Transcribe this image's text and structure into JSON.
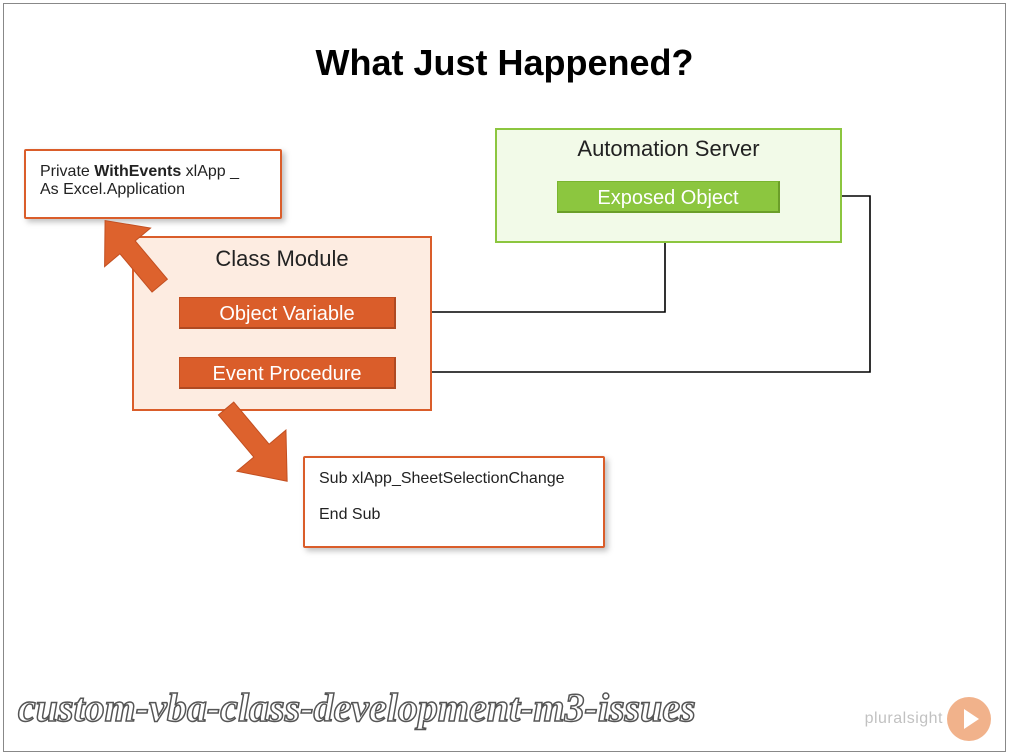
{
  "title": "What Just Happened?",
  "classModule": {
    "title": "Class Module",
    "objectVariable": "Object Variable",
    "eventProcedure": "Event Procedure"
  },
  "automationServer": {
    "title": "Automation Server",
    "exposedObject": "Exposed Object"
  },
  "calloutTop": {
    "prefix": "Private ",
    "keyword": "WithEvents",
    "suffix1": " xlApp _",
    "line2": "As Excel.Application"
  },
  "calloutBottom": {
    "line1": "Sub xlApp_SheetSelectionChange",
    "line2": "End Sub"
  },
  "watermark": "custom-vba-class-development-m3-issues",
  "brand": "pluralsight"
}
